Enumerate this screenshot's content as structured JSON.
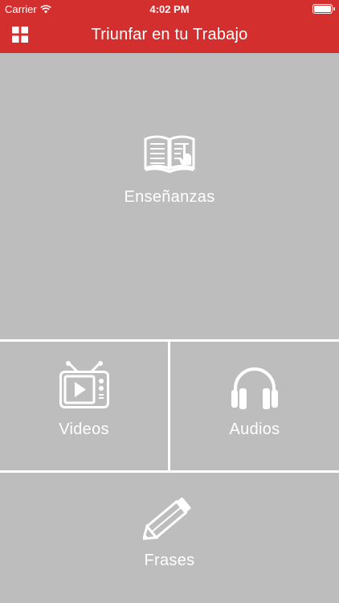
{
  "status_bar": {
    "carrier": "Carrier",
    "time": "4:02 PM",
    "wifi_icon": "wifi-icon",
    "battery_icon": "battery-icon"
  },
  "header": {
    "title": "Triunfar en tu Trabajo",
    "menu_icon": "grid-menu-icon",
    "background_color": "#d32f2f"
  },
  "tiles": [
    {
      "label": "Enseñanzas",
      "icon": "open-book-icon"
    },
    {
      "label": "Videos",
      "icon": "tv-play-icon"
    },
    {
      "label": "Audios",
      "icon": "headphones-icon"
    },
    {
      "label": "Frases",
      "icon": "pencil-icon"
    }
  ],
  "colors": {
    "tile_background": "#bdbdbd",
    "tile_foreground": "#ffffff",
    "divider": "#ffffff"
  }
}
